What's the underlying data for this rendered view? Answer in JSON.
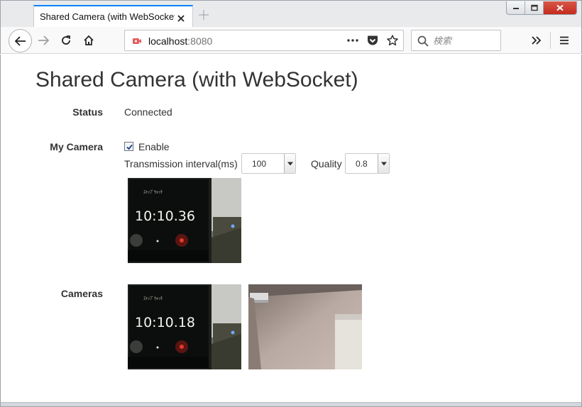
{
  "browser": {
    "tab_title": "Shared Camera (with WebSocket)",
    "url_host": "localhost",
    "url_port": ":8080",
    "search_placeholder": "検索"
  },
  "page": {
    "title": "Shared Camera (with WebSocket)",
    "status": {
      "label": "Status",
      "value": "Connected"
    },
    "my_camera": {
      "label": "My Camera",
      "enable_label": "Enable",
      "enable_checked": true,
      "interval_label": "Transmission interval(ms)",
      "interval_value": "100",
      "quality_label": "Quality",
      "quality_value": "0.8",
      "preview_clock": "10:10.36"
    },
    "cameras": {
      "label": "Cameras",
      "feeds": [
        {
          "clock": "10:10.18"
        },
        {
          "clock": ""
        }
      ]
    }
  }
}
